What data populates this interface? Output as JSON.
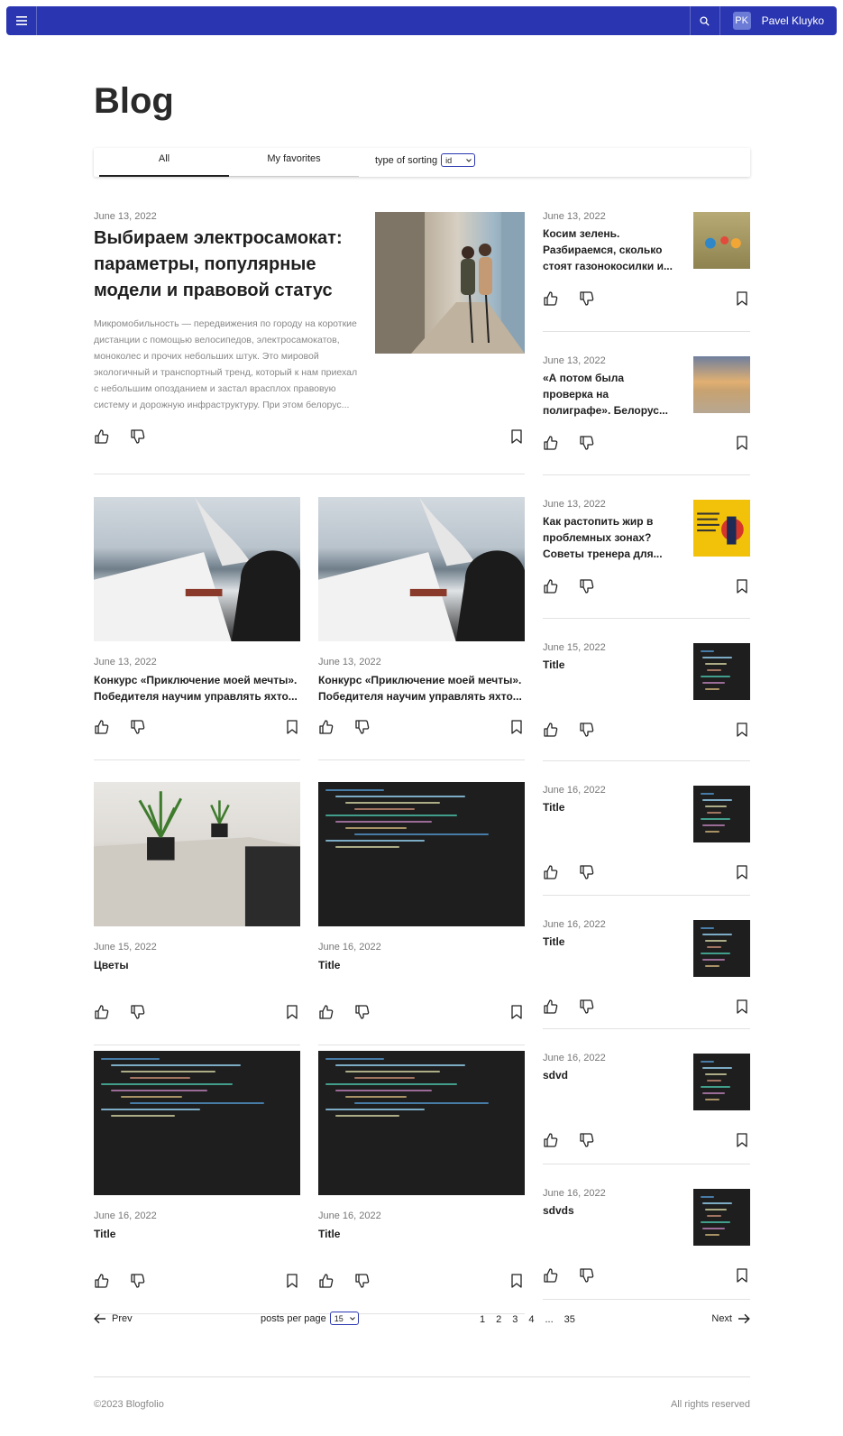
{
  "header": {
    "user_initials": "PK",
    "user_name": "Pavel Kluyko",
    "bar_color": "#2a36b1"
  },
  "page": {
    "title": "Blog"
  },
  "filters": {
    "tabs": [
      {
        "label": "All",
        "active": true
      },
      {
        "label": "My favorites",
        "active": false
      }
    ],
    "sort_label": "type of sorting",
    "sort_value": "id"
  },
  "posts": {
    "featured": {
      "date": "June 13, 2022",
      "title": "Выбираем электросамокат: параметры, популярные модели и правовой статус",
      "excerpt": "Микромобильность — передвижения по городу на короткие дистанции с помощью велосипедов, электросамокатов, моноколес и прочих небольших штук. Это мировой экологичный и транспортный тренд, который к нам приехал с небольшим опозданием и застал врасплох правовую систему и дорожную инфраструктуру. При этом белорус..."
    },
    "grid": [
      {
        "date": "June 13, 2022",
        "title": "Конкурс «Приключение моей мечты». Победителя научим управлять яхто..."
      },
      {
        "date": "June 13, 2022",
        "title": "Конкурс «Приключение моей мечты». Победителя научим управлять яхто..."
      },
      {
        "date": "June 15, 2022",
        "title": "Цветы"
      },
      {
        "date": "June 16, 2022",
        "title": "Title"
      },
      {
        "date": "June 16, 2022",
        "title": "Title"
      },
      {
        "date": "June 16, 2022",
        "title": "Title"
      }
    ],
    "sidebar": [
      {
        "date": "June 13, 2022",
        "title": "Косим зелень. Разбираемся, сколько стоят газонокосилки и..."
      },
      {
        "date": "June 13, 2022",
        "title": "«А потом была проверка на полиграфе». Белорус..."
      },
      {
        "date": "June 13, 2022",
        "title": "Как растопить жир в проблемных зонах? Советы тренера для..."
      },
      {
        "date": "June 15, 2022",
        "title": "Title"
      },
      {
        "date": "June 16, 2022",
        "title": "Title"
      },
      {
        "date": "June 16, 2022",
        "title": "Title"
      },
      {
        "date": "June 16, 2022",
        "title": "sdvd"
      },
      {
        "date": "June 16, 2022",
        "title": "sdvds"
      }
    ]
  },
  "pagination": {
    "prev_label": "Prev",
    "next_label": "Next",
    "per_page_label": "posts per page",
    "per_page_value": "15",
    "pages": [
      "1",
      "2",
      "3",
      "4",
      "...",
      "35"
    ]
  },
  "footer": {
    "copyright": "©2023 Blogfolio",
    "rights": "All rights reserved"
  },
  "icons": {
    "menu": "menu-icon",
    "search": "search-icon",
    "like": "thumbs-up-icon",
    "dislike": "thumbs-down-icon",
    "bookmark": "bookmark-icon",
    "prev": "arrow-left-icon",
    "next": "arrow-right-icon",
    "select": "chevron-down-icon"
  }
}
